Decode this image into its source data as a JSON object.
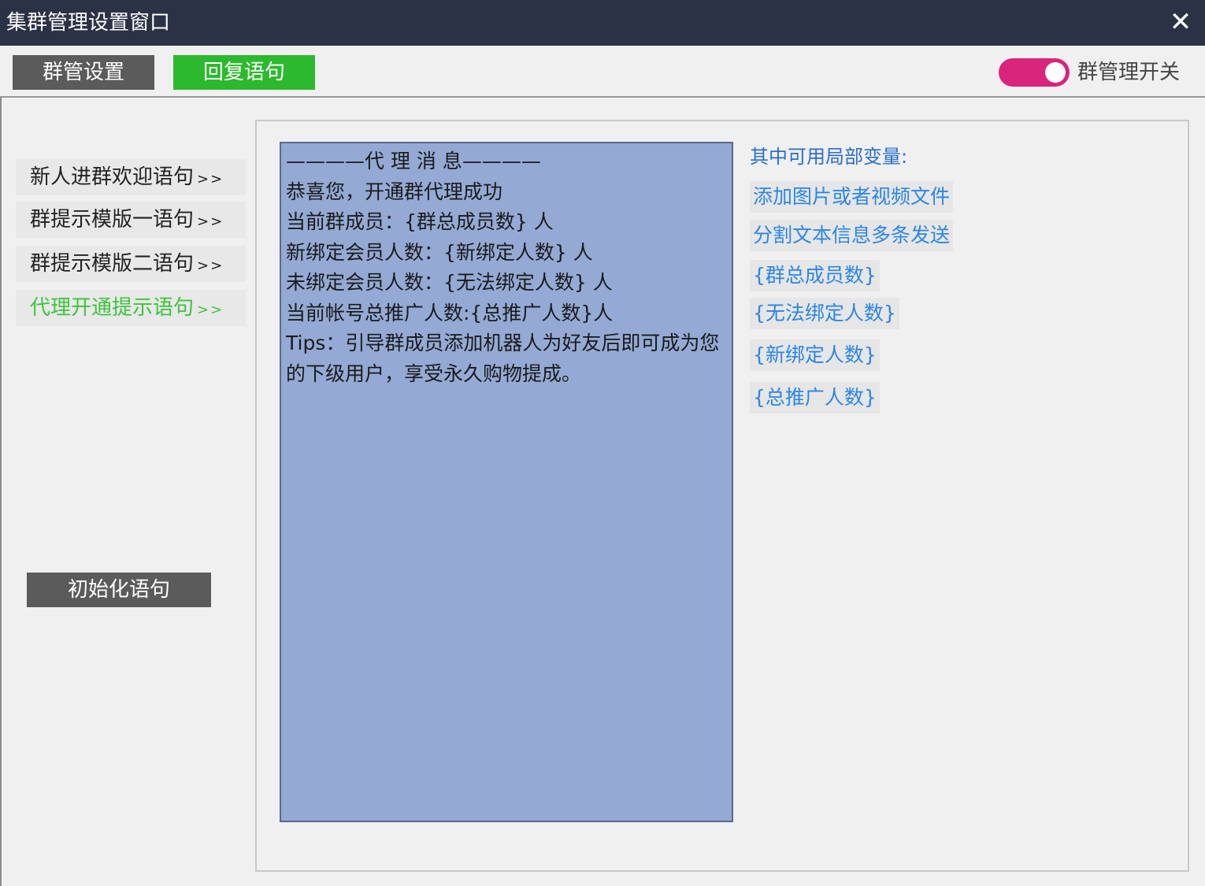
{
  "window": {
    "title": "集群管理设置窗口",
    "close_glyph": "✕"
  },
  "toolbar": {
    "tab_group_settings": "群管设置",
    "tab_reply": "回复语句",
    "toggle_label": "群管理开关",
    "toggle_on": true
  },
  "sidebar": {
    "arrow": ">>",
    "items": [
      {
        "label": "新人进群欢迎语句",
        "active": false
      },
      {
        "label": "群提示模版一语句",
        "active": false
      },
      {
        "label": "群提示模版二语句",
        "active": false
      },
      {
        "label": "代理开通提示语句",
        "active": true
      }
    ],
    "init_button": "初始化语句"
  },
  "editor": {
    "lines": [
      "————代 理 消 息————",
      "恭喜您，开通群代理成功",
      "当前群成员：{群总成员数} 人",
      "新绑定会员人数：{新绑定人数} 人",
      "未绑定会员人数：{无法绑定人数} 人",
      "当前帐号总推广人数:{总推广人数}人",
      "Tips：引导群成员添加机器人为好友后即可成为您的下级用户，享受永久购物提成。"
    ]
  },
  "variables": {
    "heading": "其中可用局部变量:",
    "links": [
      "添加图片或者视频文件",
      "分割文本信息多条发送",
      "{群总成员数}",
      "{无法绑定人数}",
      "{新绑定人数}",
      "{总推广人数}"
    ]
  },
  "colors": {
    "titlebar": "#2b3245",
    "active_green": "#2db92d",
    "toggle_pink": "#d8247b",
    "editor_bg": "#94aad4",
    "link_blue": "#2b86e6"
  }
}
